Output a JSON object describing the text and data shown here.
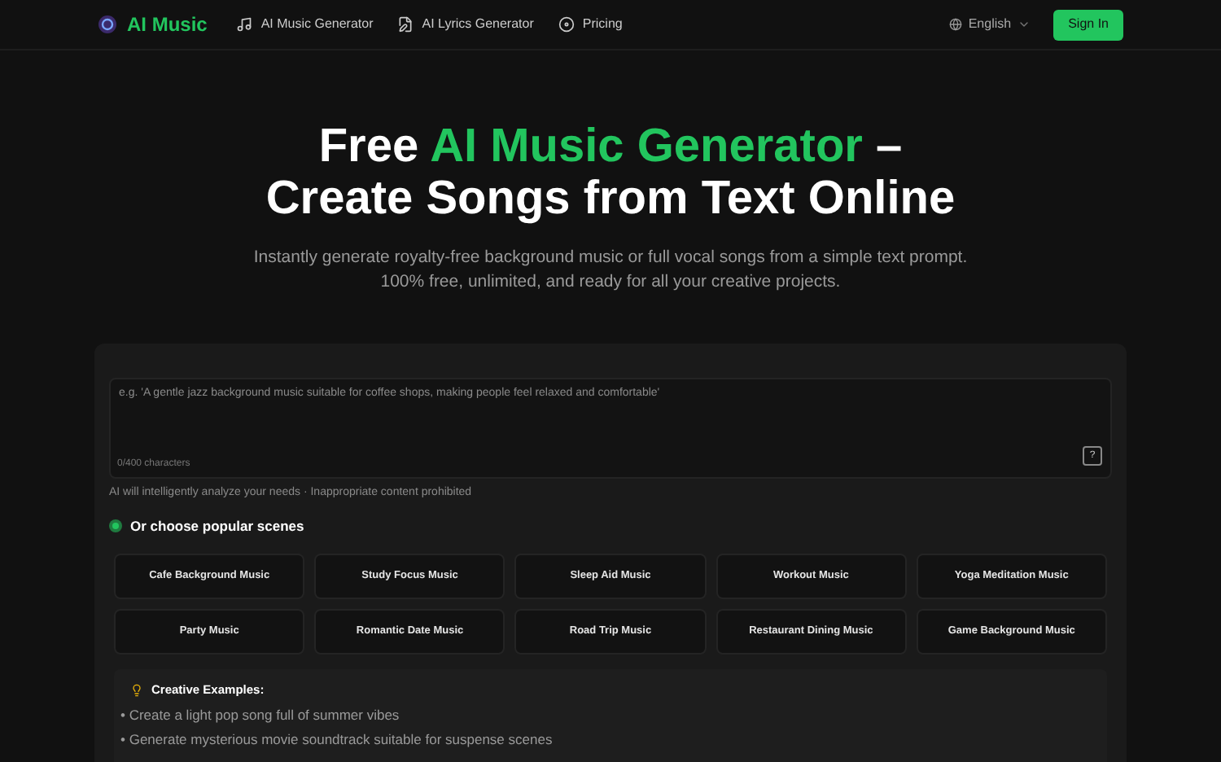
{
  "header": {
    "brand": "AI Music",
    "nav": [
      {
        "label": "AI Music Generator",
        "kind": "music"
      },
      {
        "label": "AI Lyrics Generator",
        "kind": "lyrics"
      },
      {
        "label": "Pricing",
        "kind": "pricing"
      }
    ],
    "language": "English",
    "sign_in": "Sign In"
  },
  "hero": {
    "title_start": "Free ",
    "title_highlight": "AI Music Generator",
    "title_end": " –",
    "title_line2": "Create Songs from Text Online",
    "subtitle_line1": "Instantly generate royalty-free background music or full vocal songs from a simple text prompt.",
    "subtitle_line2": "100% free, unlimited, and ready for all your creative projects."
  },
  "prompt": {
    "placeholder": "e.g. 'A gentle jazz background music suitable for coffee shops, making people feel relaxed and comfortable'",
    "counter": "0/400 characters",
    "help_button": "?",
    "note": "AI will intelligently analyze your needs · Inappropriate content prohibited"
  },
  "scenes": {
    "heading": "Or choose popular scenes",
    "items": [
      "Cafe Background Music",
      "Study Focus Music",
      "Sleep Aid Music",
      "Workout Music",
      "Yoga Meditation Music",
      "Party Music",
      "Romantic Date Music",
      "Road Trip Music",
      "Restaurant Dining Music",
      "Game Background Music"
    ]
  },
  "examples": {
    "heading": "Creative Examples:",
    "items": [
      "• Create a light pop song full of summer vibes",
      "• Generate mysterious movie soundtrack suitable for suspense scenes"
    ]
  }
}
